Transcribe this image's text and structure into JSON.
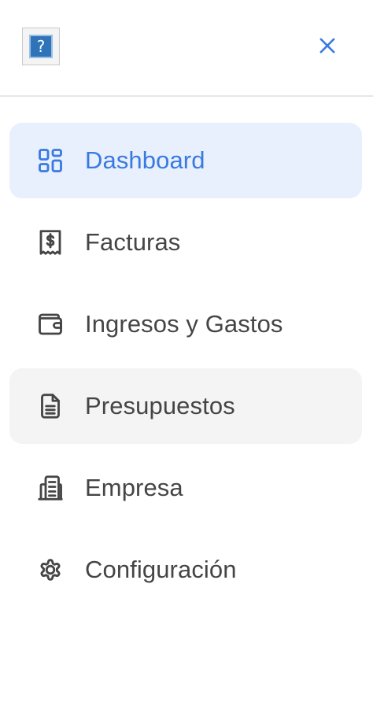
{
  "header": {
    "logo_glyph": "?",
    "close_icon": "close-icon"
  },
  "nav": {
    "items": [
      {
        "label": "Dashboard",
        "icon": "dashboard-grid-icon",
        "state": "active"
      },
      {
        "label": "Facturas",
        "icon": "receipt-icon",
        "state": "default"
      },
      {
        "label": "Ingresos y Gastos",
        "icon": "wallet-icon",
        "state": "default"
      },
      {
        "label": "Presupuestos",
        "icon": "document-icon",
        "state": "hover"
      },
      {
        "label": "Empresa",
        "icon": "building-icon",
        "state": "default"
      },
      {
        "label": "Configuración",
        "icon": "gear-icon",
        "state": "default"
      }
    ]
  },
  "colors": {
    "active_bg": "#e8f0fd",
    "active_text": "#3a7ae0",
    "hover_bg": "#f4f4f4",
    "text": "#454545",
    "divider": "#e6e6e6"
  }
}
